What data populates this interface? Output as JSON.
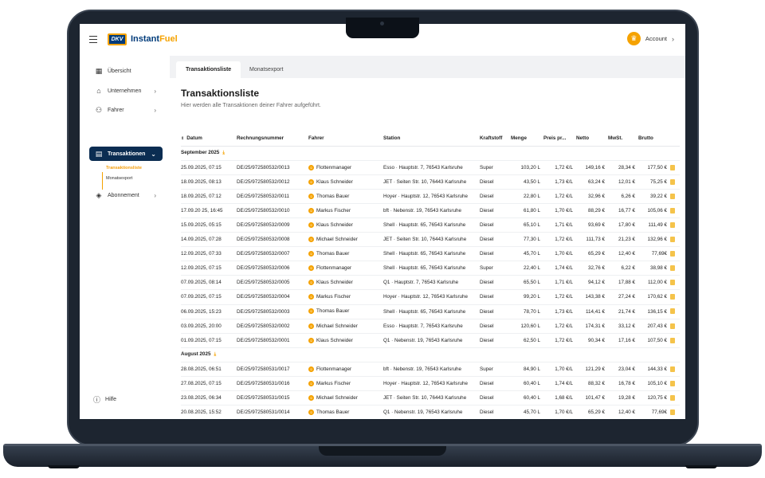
{
  "header": {
    "logo_text": "DKV",
    "brand_main": "Instant",
    "brand_accent": "Fuel",
    "account_label": "Account"
  },
  "sidebar": {
    "items": [
      {
        "label": "Übersicht",
        "icon": "dashboard-icon"
      },
      {
        "label": "Unternehmen",
        "icon": "home-icon"
      },
      {
        "label": "Fahrer",
        "icon": "users-icon"
      },
      {
        "label": "Transaktionen",
        "icon": "document-icon"
      },
      {
        "label": "Abonnement",
        "icon": "box-icon"
      }
    ],
    "sub_items": [
      "Transaktionsliste",
      "Monatsexport"
    ],
    "help_label": "Hilfe"
  },
  "tabs": [
    "Transaktionsliste",
    "Monatsexport"
  ],
  "page": {
    "title": "Transaktionsliste",
    "subtitle": "Hier werden alle Transaktionen deiner Fahrer aufgeführt."
  },
  "table": {
    "columns": [
      "Datum",
      "Rechnungsnummer",
      "Fahrer",
      "Station",
      "Kraftstoff",
      "Menge",
      "Preis pr...",
      "Netto",
      "MwSt.",
      "Brutto"
    ],
    "groups": [
      {
        "label": "September 2025",
        "rows": [
          [
            "25.09.2025, 07:15",
            "DE/25/972580532/0013",
            "Flottenmanager",
            "Esso · Hauptstr. 7, 76543 Karlsruhe",
            "Super",
            "103,20 L",
            "1,72 €/L",
            "149,16 €",
            "28,34 €",
            "177,50 €"
          ],
          [
            "18.09.2025, 08:13",
            "DE/25/972580532/0012",
            "Klaus Schneider",
            "JET · Seiten Str. 10, 76443 Karlsruhe",
            "Diesel",
            "43,50 L",
            "1,73 €/L",
            "63,24 €",
            "12,01 €",
            "75,25 €"
          ],
          [
            "18.09.2025, 07:12",
            "DE/25/972580532/0011",
            "Thomas Bauer",
            "Hoyer · Hauptstr. 12, 76543 Karlsruhe",
            "Diesel",
            "22,80 L",
            "1,72 €/L",
            "32,96 €",
            "6,26 €",
            "39,22 €"
          ],
          [
            "17.09.20 25, 16:45",
            "DE/25/972580532/0010",
            "Markus Fischer",
            "bft · Nebenstr. 19, 76543 Karlsruhe",
            "Diesel",
            "61,80 L",
            "1,70 €/L",
            "88,29 €",
            "16,77 €",
            "105,06 €"
          ],
          [
            "15.09.2025, 05:15",
            "DE/25/972580532/0009",
            "Klaus Schneider",
            "Shell · Hauptstr. 65, 76543 Karlsruhe",
            "Diesel",
            "65,10 L",
            "1,71 €/L",
            "93,69 €",
            "17,80 €",
            "111,49 €"
          ],
          [
            "14.09.2025, 07:28",
            "DE/25/972580532/0008",
            "Michael Schneider",
            "JET · Seiten Str. 10, 76443 Karlsruhe",
            "Diesel",
            "77,30 L",
            "1,72 €/L",
            "111,73 €",
            "21,23 €",
            "132,96 €"
          ],
          [
            "12.09.2025, 07:33",
            "DE/25/972580532/0007",
            "Thomas Bauer",
            "Shell · Hauptstr. 65, 76543 Karlsruhe",
            "Diesel",
            "45,70 L",
            "1,70 €/L",
            "65,29 €",
            "12,40 €",
            "77,69€"
          ],
          [
            "12.09.2025, 07:15",
            "DE/25/972580532/0006",
            "Flottenmanager",
            "Shell · Hauptstr. 65, 76543 Karlsruhe",
            "Super",
            "22,40 L",
            "1,74 €/L",
            "32,76 €",
            "6,22 €",
            "38,98 €"
          ],
          [
            "07.09.2025, 08:14",
            "DE/25/972580532/0005",
            "Klaus Schneider",
            "Q1 · Hauptstr. 7, 76543 Karlsruhe",
            "Diesel",
            "65,50 L",
            "1,71 €/L",
            "94,12 €",
            "17,88 €",
            "112,00 €"
          ],
          [
            "07.09.2025, 07:15",
            "DE/25/972580532/0004",
            "Markus Fischer",
            "Hoyer · Hauptstr. 12, 76543 Karlsruhe",
            "Diesel",
            "99,20 L",
            "1,72 €/L",
            "143,38 €",
            "27,24 €",
            "170,62 €"
          ],
          [
            "06.09.2025, 15:23",
            "DE/25/972580532/0003",
            "Thomas Bauer",
            "Shell · Hauptstr. 65, 76543 Karlsruhe",
            "Diesel",
            "78,70 L",
            "1,73 €/L",
            "114,41 €",
            "21,74 €",
            "136,15 €"
          ],
          [
            "03.09.2025, 20:00",
            "DE/25/972580532/0002",
            "Michael Schneider",
            "Esso · Hauptstr. 7, 76543 Karlsruhe",
            "Diesel",
            "120,60 L",
            "1,72 €/L",
            "174,31 €",
            "33,12 €",
            "207,43 €"
          ],
          [
            "01.09.2025, 07:15",
            "DE/25/972580532/0001",
            "Klaus Schneider",
            "Q1 · Nebenstr. 19, 76543 Karlsruhe",
            "Diesel",
            "62,50 L",
            "1,72 €/L",
            "90,34 €",
            "17,16 €",
            "107,50 €"
          ]
        ]
      },
      {
        "label": "August 2025",
        "rows": [
          [
            "28.08.2025, 06:51",
            "DE/25/972580531/0017",
            "Flottenmanager",
            "bft · Nebenstr. 19, 76543 Karlsruhe",
            "Super",
            "84,90 L",
            "1,70 €/L",
            "121,29 €",
            "23,04 €",
            "144,33 €"
          ],
          [
            "27.08.2025, 07:15",
            "DE/25/972580531/0016",
            "Markus Fischer",
            "Hoyer · Hauptstr. 12, 76543 Karlsruhe",
            "Diesel",
            "60,40 L",
            "1,74 €/L",
            "88,32 €",
            "16,78 €",
            "105,10 €"
          ],
          [
            "23.08.2025, 06:34",
            "DE/25/972580531/0015",
            "Michael Schneider",
            "JET · Seiten Str. 10, 76443 Karlsruhe",
            "Diesel",
            "60,40 L",
            "1,68 €/L",
            "101,47 €",
            "19,28 €",
            "120,75 €"
          ],
          [
            "20.08.2025, 15:52",
            "DE/25/972580531/0014",
            "Thomas Bauer",
            "Q1 · Nebenstr. 19, 76543 Karlsruhe",
            "Diesel",
            "45,70 L",
            "1,70 €/L",
            "65,29 €",
            "12,40 €",
            "77,69€"
          ]
        ]
      }
    ]
  }
}
